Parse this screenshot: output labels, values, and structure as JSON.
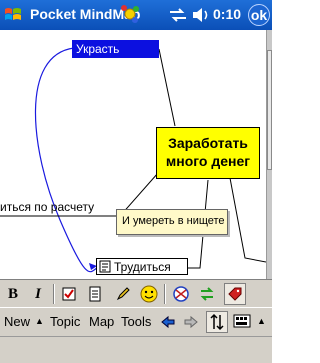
{
  "titlebar": {
    "app_title": "Pocket MindMap",
    "clock": "0:10",
    "ok_label": "ok"
  },
  "map": {
    "top_node": "Украсть",
    "main_node_line1": "Заработать",
    "main_node_line2": "много денег",
    "left_node": "иться по расчету",
    "tooltip": "И умереть в нищете",
    "work_node": "Трудиться",
    "colors": {
      "top_node_bg": "#0c10e0",
      "main_node_bg": "#ffff00",
      "tooltip_bg": "#fff9c9",
      "curve": "#1a1adf"
    }
  },
  "toolbar": {
    "bold": "B",
    "italic": "I",
    "icons": [
      "bold-icon",
      "italic-icon",
      "checkbox-icon",
      "notes-icon",
      "pencil-icon",
      "smiley-icon",
      "link-icon",
      "swap-icon",
      "tag-icon"
    ]
  },
  "menubar": {
    "items": [
      "New",
      "Topic",
      "Map",
      "Tools"
    ]
  }
}
